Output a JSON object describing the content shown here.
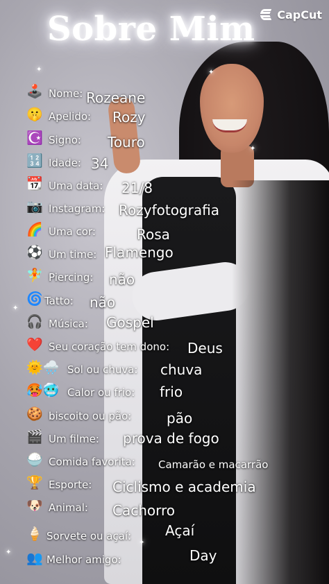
{
  "title": "Sobre Mim",
  "watermark": {
    "brand": "CapCut",
    "icon": "capcut-logo-icon"
  },
  "fields": [
    {
      "emoji": "🕹️",
      "label": "Nome:",
      "value": "Rozeane"
    },
    {
      "emoji": "🤫",
      "label": "Apelido:",
      "value": "Rozy"
    },
    {
      "emoji": "☪️",
      "label": "Signo:",
      "value": "Touro"
    },
    {
      "emoji": "🔢",
      "label": "Idade:",
      "value": "34"
    },
    {
      "emoji": "📆",
      "label": "Uma data:",
      "value": "21/8"
    },
    {
      "emoji": "📷",
      "label": "Instagram:",
      "value": "Rozyfotografia"
    },
    {
      "emoji": "🌈",
      "label": "Uma cor:",
      "value": "Rosa"
    },
    {
      "emoji": "⚽",
      "label": "Um time:",
      "value": "Flamengo"
    },
    {
      "emoji": "🧚",
      "label": "Piercing:",
      "value": "não"
    },
    {
      "emoji": "🌀",
      "label": "Tatto:",
      "value": "não"
    },
    {
      "emoji": "🎧",
      "label": "Música:",
      "value": "Gospel"
    },
    {
      "emoji": "❤️",
      "label": "Seu coração tem dono:",
      "value": "Deus"
    },
    {
      "emoji": "🌞🌧️",
      "label": "Sol ou chuva:",
      "value": "chuva"
    },
    {
      "emoji": "🥵🥶",
      "label": "Calor ou frio:",
      "value": "frio"
    },
    {
      "emoji": "🍪",
      "label": "biscoito ou pão:",
      "value": "pão"
    },
    {
      "emoji": "🎬",
      "label": "Um filme:",
      "value": "prova de fogo"
    },
    {
      "emoji": "🍚",
      "label": "Comida favorita:",
      "value": "Camarão e macarrão"
    },
    {
      "emoji": "🏆",
      "label": "Esporte:",
      "value": "Ciclismo e academia"
    },
    {
      "emoji": "🐶",
      "label": "Animal:",
      "value": "Cachorro"
    },
    {
      "emoji": "🍦",
      "label": "Sorvete ou açaí:",
      "value": "Açaí"
    },
    {
      "emoji": "👥",
      "label": "Melhor amigo:",
      "value": "Day"
    }
  ]
}
